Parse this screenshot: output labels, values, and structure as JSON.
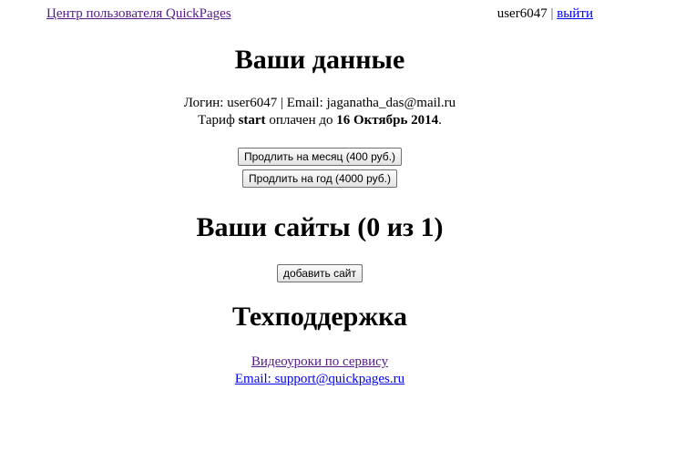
{
  "header": {
    "home_link": "Центр пользователя QuickPages",
    "username": "user6047",
    "separator": "|",
    "logout_link": "выйти"
  },
  "account": {
    "title": "Ваши данные",
    "login_label": "Логин:",
    "login_value": "user6047",
    "email_label": "Email:",
    "email_value": "jaganatha_das@mail.ru",
    "tariff_label": "Тариф",
    "tariff_name": "start",
    "paid_until_label": "оплачен до",
    "paid_until_date": "16 Октябрь 2014",
    "renew_month_button": "Продлить на месяц (400 руб.)",
    "renew_year_button": "Продлить на год (4000 руб.)"
  },
  "sites": {
    "title": "Ваши сайты (0 из 1)",
    "add_button": "добавить сайт"
  },
  "support": {
    "title": "Техподдержка",
    "video_link": "Видеоуроки по сервису",
    "email_link": "Email: support@quickpages.ru"
  }
}
